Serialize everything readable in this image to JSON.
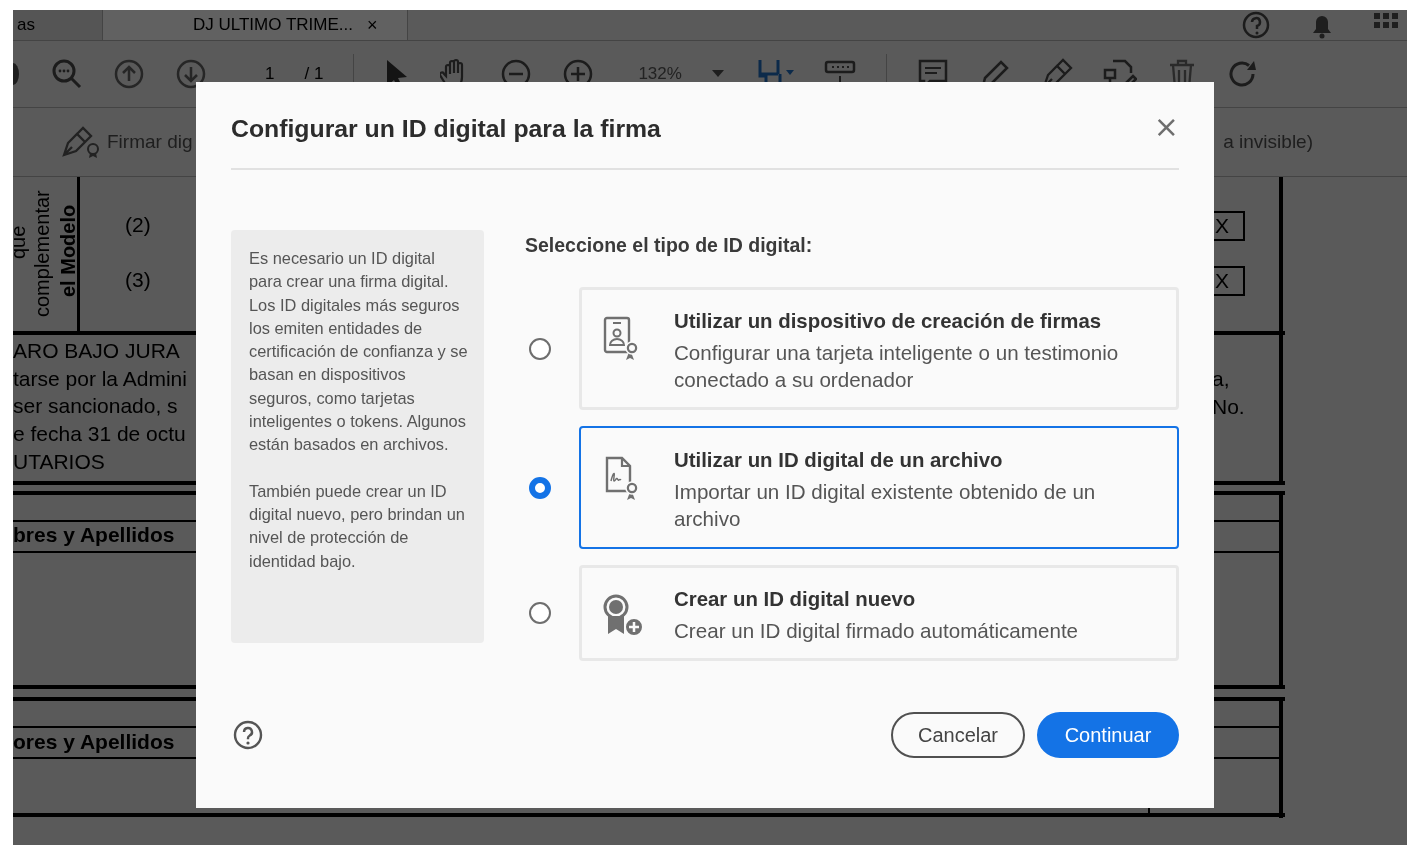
{
  "app": {
    "tabs": [
      {
        "label": "as",
        "selected": false
      },
      {
        "label": "DJ ULTIMO TRIME...",
        "selected": true,
        "close": "×"
      }
    ],
    "toolbar": {
      "page_current": "1",
      "page_total": "/ 1",
      "zoom": "132%"
    },
    "sign_bar": {
      "left_label": "Firmar dig",
      "right_label": "a invisible)"
    },
    "document": {
      "side_labels": [
        "que",
        "complementar",
        "el Modelo"
      ],
      "markers": [
        "(2)",
        "(3)"
      ],
      "declaration_lines": [
        "ARO BAJO JURA",
        "tarse por la Admini",
        "ser sancionado, s",
        "e fecha 31 de octu",
        "UTARIOS"
      ],
      "check_marks": [
        "X",
        "X"
      ],
      "right_lines": [
        "a,",
        "No."
      ],
      "name_headers": [
        "bres y Apellidos",
        "ores y Apellidos"
      ]
    }
  },
  "dialog": {
    "title": "Configurar un ID digital para la firma",
    "close": "×",
    "info": [
      "Es necesario un ID digital para crear una firma digital. Los ID digitales más seguros los emiten entidades de certificación de confianza y se basan en dispositivos seguros, como tarjetas inteligentes o tokens. Algunos están basados en archivos.",
      "También puede crear un ID digital nuevo, pero brindan un nivel de protección de identidad bajo."
    ],
    "prompt": "Seleccione el tipo de ID digital:",
    "options": [
      {
        "kind": "device",
        "title": "Utilizar un dispositivo de creación de firmas",
        "description": "Configurar una tarjeta inteligente o un testimonio conectado a su ordenador",
        "selected": false
      },
      {
        "kind": "file",
        "title": "Utilizar un ID digital de un archivo",
        "description": "Importar un ID digital existente obtenido de un archivo",
        "selected": true
      },
      {
        "kind": "new",
        "title": "Crear un ID digital nuevo",
        "description": "Crear un ID digital firmado automáticamente",
        "selected": false
      }
    ],
    "buttons": [
      {
        "kind": "secondary",
        "label": "Cancelar"
      },
      {
        "kind": "primary",
        "label": "Continuar"
      }
    ]
  }
}
